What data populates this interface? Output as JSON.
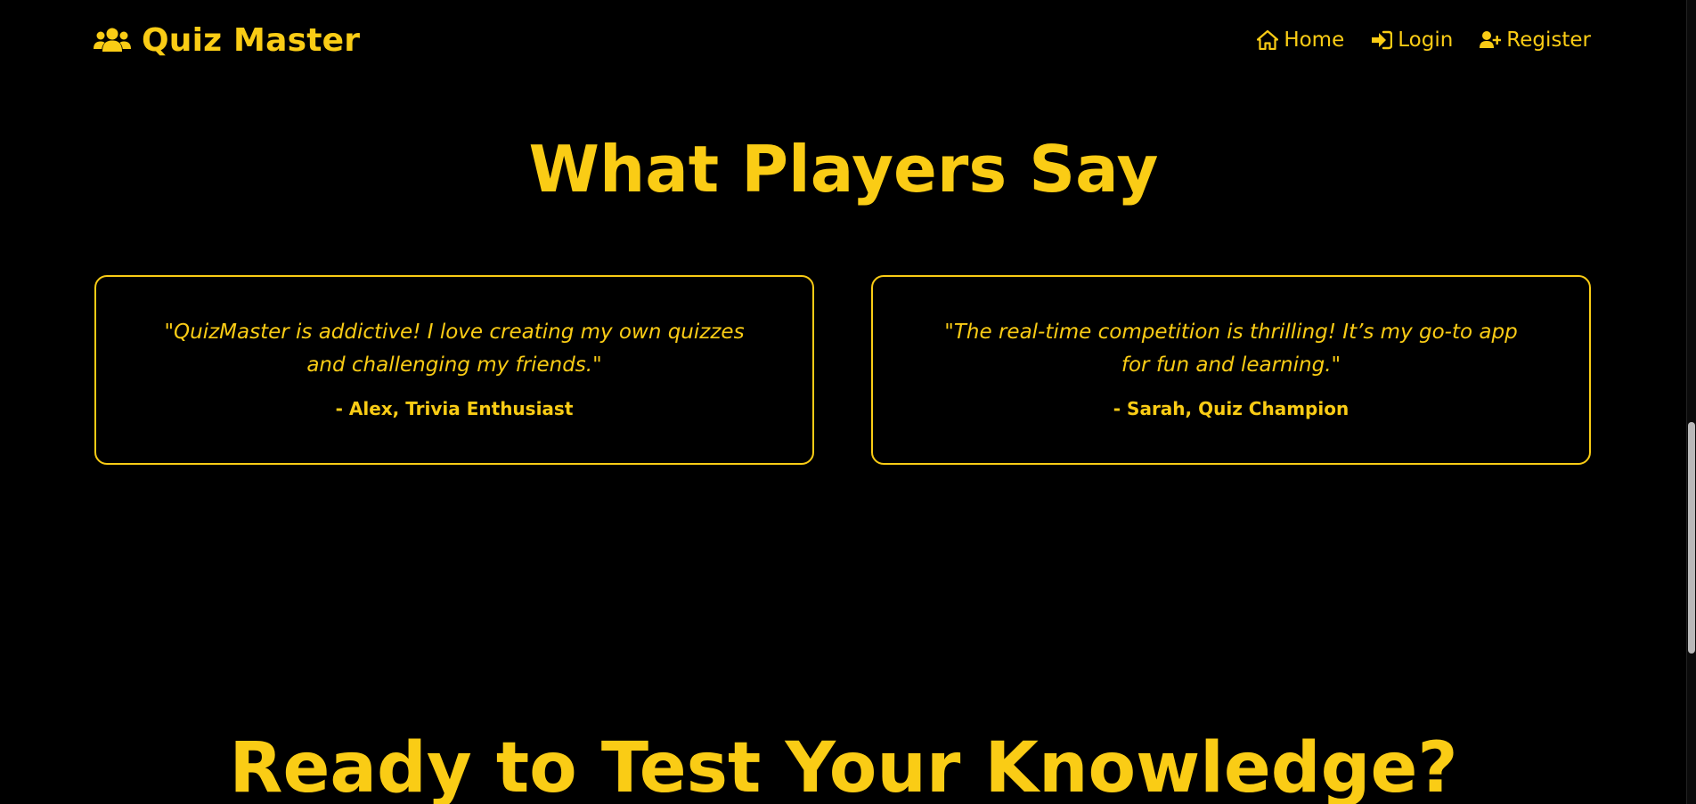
{
  "brand": {
    "name": "Quiz Master",
    "icon": "users-icon"
  },
  "nav": {
    "items": [
      {
        "label": "Home",
        "icon": "home-icon"
      },
      {
        "label": "Login",
        "icon": "sign-in-icon"
      },
      {
        "label": "Register",
        "icon": "user-plus-icon"
      }
    ]
  },
  "testimonials": {
    "title": "What Players Say",
    "items": [
      {
        "quote": "\"QuizMaster is addictive! I love creating my own quizzes and challenging my friends.\"",
        "author": "- Alex, Trivia Enthusiast"
      },
      {
        "quote": "\"The real-time competition is thrilling! It’s my go-to app for fun and learning.\"",
        "author": "- Sarah, Quiz Champion"
      }
    ]
  },
  "cta": {
    "title": "Ready to Test Your Knowledge?"
  },
  "colors": {
    "background": "#000000",
    "accent": "#FACC15",
    "scrollbar_thumb": "#B9B9B9"
  }
}
